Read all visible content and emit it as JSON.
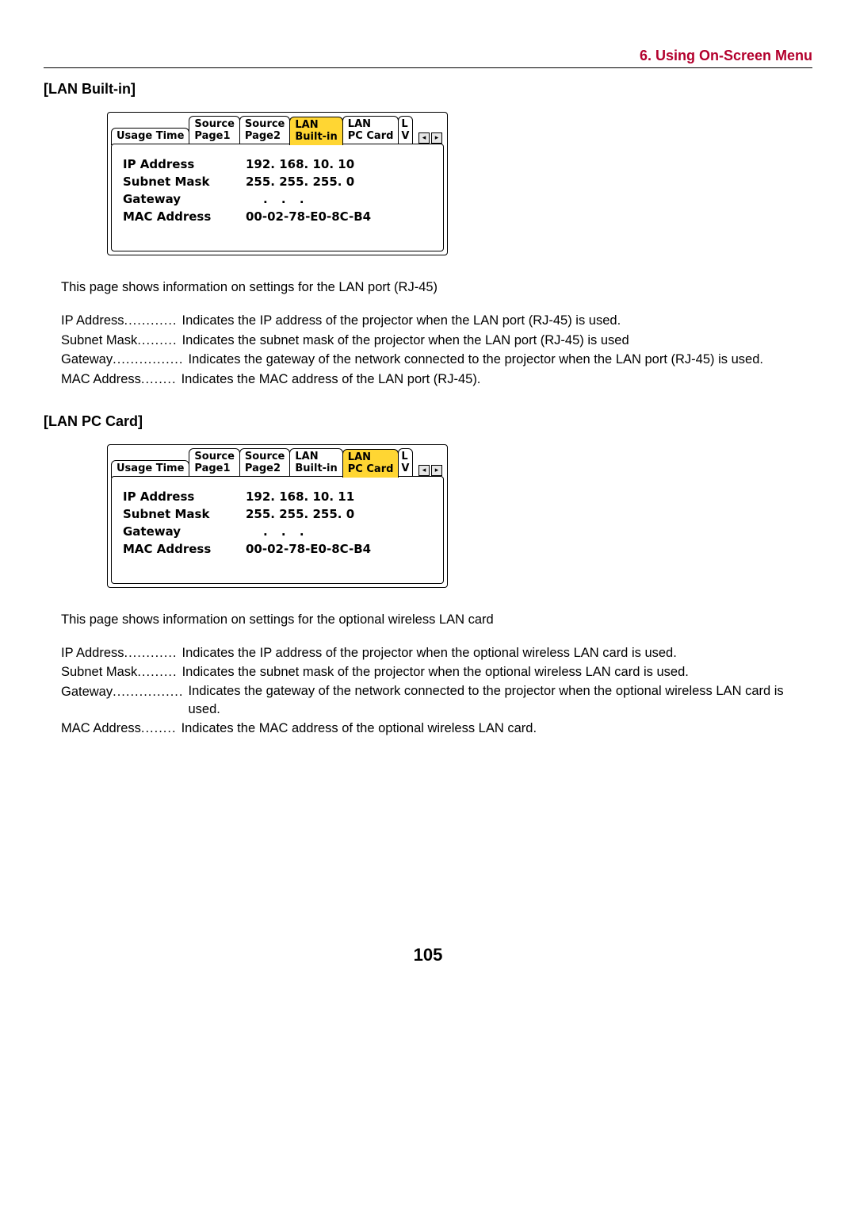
{
  "chapter": "6. Using On-Screen Menu",
  "sec1": {
    "title": "[LAN Built-in]",
    "osd": {
      "tabs": [
        {
          "label": "Usage Time",
          "sel": false
        },
        {
          "label": "Source\nPage1",
          "sel": false
        },
        {
          "label": "Source\nPage2",
          "sel": false
        },
        {
          "label": "LAN\nBuilt-in",
          "sel": true
        },
        {
          "label": "LAN\nPC Card",
          "sel": false
        },
        {
          "label": "L\nV",
          "sel": false,
          "trunc": true
        }
      ],
      "rows": {
        "ip_label": "IP Address",
        "ip_val": "192. 168.  10.  10",
        "sm_label": "Subnet Mask",
        "sm_val": "255. 255. 255.    0",
        "gw_label": "Gateway",
        "gw_val": ".   .   .",
        "mac_label": "MAC Address",
        "mac_val": "00-02-78-E0-8C-B4"
      }
    },
    "intro": "This page shows information on settings for the LAN port (RJ-45)",
    "defs": [
      {
        "term": "IP Address",
        "dots": "............",
        "desc": "Indicates the IP address of the projector when the LAN port (RJ-45) is used."
      },
      {
        "term": "Subnet Mask",
        "dots": ".........",
        "desc": "Indicates the subnet mask of the projector when the LAN port (RJ-45) is used"
      },
      {
        "term": "Gateway",
        "dots": "................",
        "desc": "Indicates the gateway of the network connected to the projector when the LAN port (RJ-45) is used."
      },
      {
        "term": "MAC Address",
        "dots": "........",
        "desc": "Indicates the MAC address of the LAN port (RJ-45)."
      }
    ]
  },
  "sec2": {
    "title": "[LAN PC Card]",
    "osd": {
      "tabs": [
        {
          "label": "Usage Time",
          "sel": false
        },
        {
          "label": "Source\nPage1",
          "sel": false
        },
        {
          "label": "Source\nPage2",
          "sel": false
        },
        {
          "label": "LAN\nBuilt-in",
          "sel": false
        },
        {
          "label": "LAN\nPC Card",
          "sel": true
        },
        {
          "label": "L\nV",
          "sel": false,
          "trunc": true
        }
      ],
      "rows": {
        "ip_label": "IP Address",
        "ip_val": "192. 168.  10.  11",
        "sm_label": "Subnet Mask",
        "sm_val": "255. 255. 255.    0",
        "gw_label": "Gateway",
        "gw_val": ".   .   .",
        "mac_label": "MAC Address",
        "mac_val": "00-02-78-E0-8C-B4"
      }
    },
    "intro": "This page shows information on settings for the optional wireless LAN card",
    "defs": [
      {
        "term": "IP Address",
        "dots": "............",
        "desc": "Indicates the IP address of the projector when the optional wireless LAN card is used."
      },
      {
        "term": "Subnet Mask",
        "dots": ".........",
        "desc": "Indicates the subnet mask of the projector when the optional wireless LAN card is used."
      },
      {
        "term": "Gateway",
        "dots": "................",
        "desc": "Indicates the gateway of the network connected to the projector when the optional wireless LAN card is used."
      },
      {
        "term": "MAC Address",
        "dots": "........",
        "desc": "Indicates the MAC address of the optional wireless LAN card."
      }
    ]
  },
  "page_number": "105"
}
